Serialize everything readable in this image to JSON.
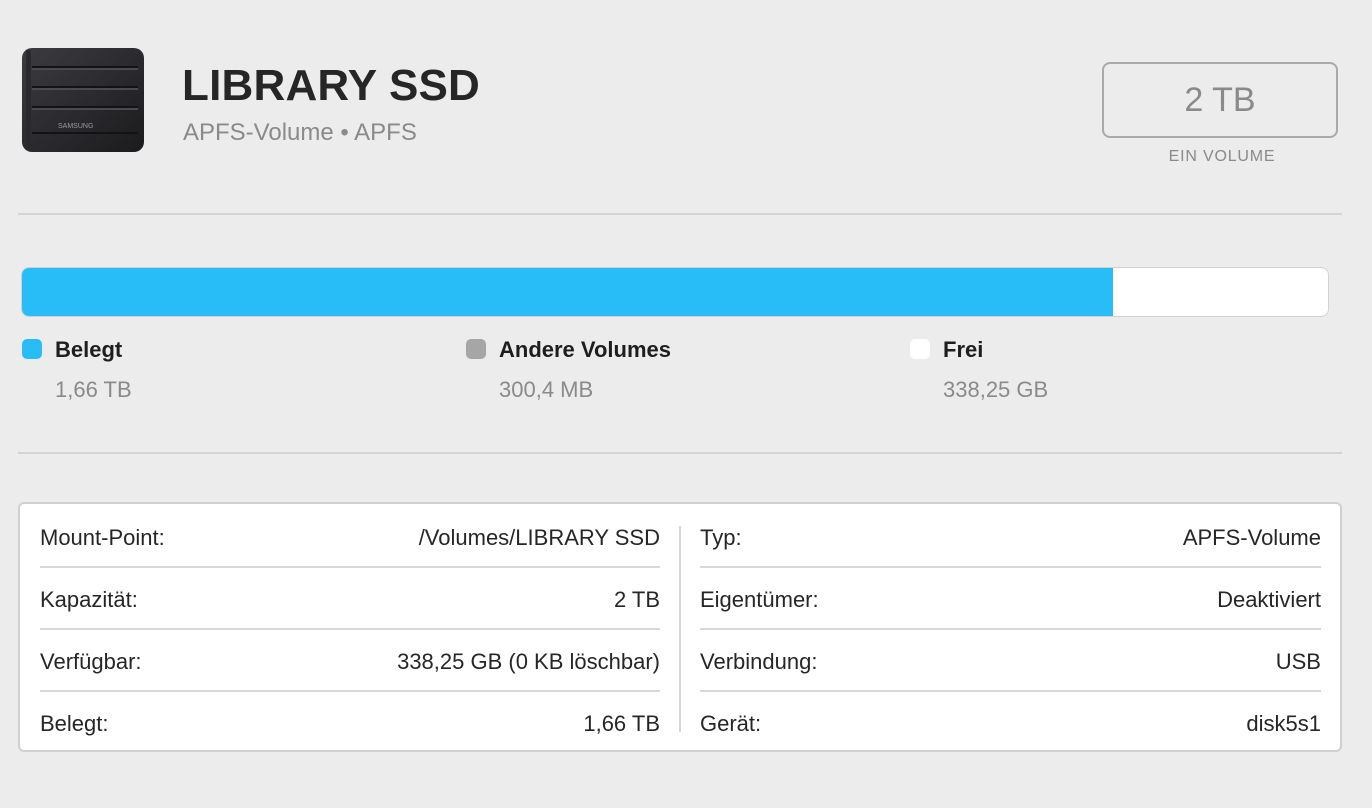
{
  "header": {
    "title": "LIBRARY SSD",
    "subtitle": "APFS-Volume • APFS",
    "device_brand": "SAMSUNG",
    "size_value": "2 TB",
    "size_caption": "EIN VOLUME"
  },
  "usage": {
    "used_fraction": 0.835,
    "colors": {
      "used": "#29bdf8",
      "other": "#a6a6a6",
      "free": "#ffffff"
    },
    "legend": [
      {
        "label": "Belegt",
        "value": "1,66 TB"
      },
      {
        "label": "Andere Volumes",
        "value": "300,4 MB"
      },
      {
        "label": "Frei",
        "value": "338,25 GB"
      }
    ]
  },
  "info": {
    "left": [
      {
        "key": "Mount-Point:",
        "value": "/Volumes/LIBRARY SSD"
      },
      {
        "key": "Kapazität:",
        "value": "2 TB"
      },
      {
        "key": "Verfügbar:",
        "value": "338,25 GB (0 KB löschbar)"
      },
      {
        "key": "Belegt:",
        "value": "1,66 TB"
      }
    ],
    "right": [
      {
        "key": "Typ:",
        "value": "APFS-Volume"
      },
      {
        "key": "Eigentümer:",
        "value": "Deaktiviert"
      },
      {
        "key": "Verbindung:",
        "value": "USB"
      },
      {
        "key": "Gerät:",
        "value": "disk5s1"
      }
    ]
  }
}
